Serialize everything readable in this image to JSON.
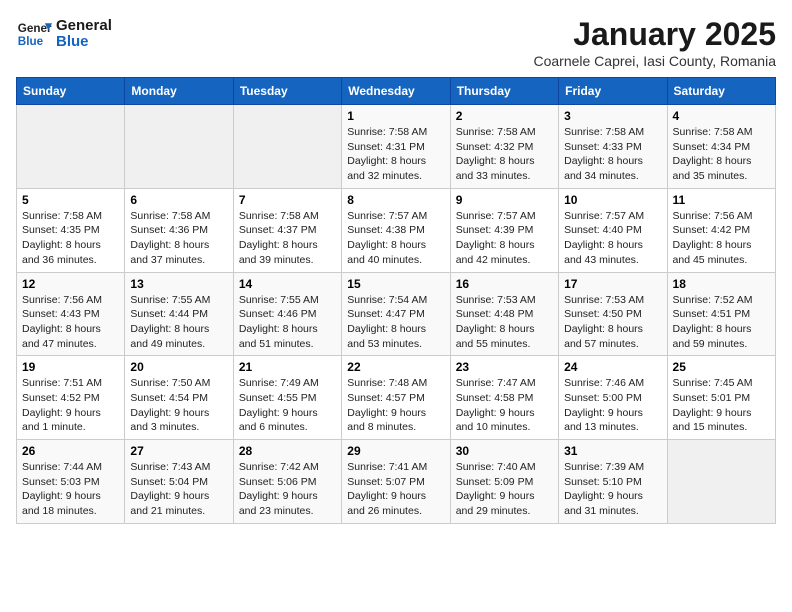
{
  "header": {
    "logo_line1": "General",
    "logo_line2": "Blue",
    "title": "January 2025",
    "subtitle": "Coarnele Caprei, Iasi County, Romania"
  },
  "weekdays": [
    "Sunday",
    "Monday",
    "Tuesday",
    "Wednesday",
    "Thursday",
    "Friday",
    "Saturday"
  ],
  "weeks": [
    [
      {
        "day": "",
        "info": ""
      },
      {
        "day": "",
        "info": ""
      },
      {
        "day": "",
        "info": ""
      },
      {
        "day": "1",
        "info": "Sunrise: 7:58 AM\nSunset: 4:31 PM\nDaylight: 8 hours and 32 minutes."
      },
      {
        "day": "2",
        "info": "Sunrise: 7:58 AM\nSunset: 4:32 PM\nDaylight: 8 hours and 33 minutes."
      },
      {
        "day": "3",
        "info": "Sunrise: 7:58 AM\nSunset: 4:33 PM\nDaylight: 8 hours and 34 minutes."
      },
      {
        "day": "4",
        "info": "Sunrise: 7:58 AM\nSunset: 4:34 PM\nDaylight: 8 hours and 35 minutes."
      }
    ],
    [
      {
        "day": "5",
        "info": "Sunrise: 7:58 AM\nSunset: 4:35 PM\nDaylight: 8 hours and 36 minutes."
      },
      {
        "day": "6",
        "info": "Sunrise: 7:58 AM\nSunset: 4:36 PM\nDaylight: 8 hours and 37 minutes."
      },
      {
        "day": "7",
        "info": "Sunrise: 7:58 AM\nSunset: 4:37 PM\nDaylight: 8 hours and 39 minutes."
      },
      {
        "day": "8",
        "info": "Sunrise: 7:57 AM\nSunset: 4:38 PM\nDaylight: 8 hours and 40 minutes."
      },
      {
        "day": "9",
        "info": "Sunrise: 7:57 AM\nSunset: 4:39 PM\nDaylight: 8 hours and 42 minutes."
      },
      {
        "day": "10",
        "info": "Sunrise: 7:57 AM\nSunset: 4:40 PM\nDaylight: 8 hours and 43 minutes."
      },
      {
        "day": "11",
        "info": "Sunrise: 7:56 AM\nSunset: 4:42 PM\nDaylight: 8 hours and 45 minutes."
      }
    ],
    [
      {
        "day": "12",
        "info": "Sunrise: 7:56 AM\nSunset: 4:43 PM\nDaylight: 8 hours and 47 minutes."
      },
      {
        "day": "13",
        "info": "Sunrise: 7:55 AM\nSunset: 4:44 PM\nDaylight: 8 hours and 49 minutes."
      },
      {
        "day": "14",
        "info": "Sunrise: 7:55 AM\nSunset: 4:46 PM\nDaylight: 8 hours and 51 minutes."
      },
      {
        "day": "15",
        "info": "Sunrise: 7:54 AM\nSunset: 4:47 PM\nDaylight: 8 hours and 53 minutes."
      },
      {
        "day": "16",
        "info": "Sunrise: 7:53 AM\nSunset: 4:48 PM\nDaylight: 8 hours and 55 minutes."
      },
      {
        "day": "17",
        "info": "Sunrise: 7:53 AM\nSunset: 4:50 PM\nDaylight: 8 hours and 57 minutes."
      },
      {
        "day": "18",
        "info": "Sunrise: 7:52 AM\nSunset: 4:51 PM\nDaylight: 8 hours and 59 minutes."
      }
    ],
    [
      {
        "day": "19",
        "info": "Sunrise: 7:51 AM\nSunset: 4:52 PM\nDaylight: 9 hours and 1 minute."
      },
      {
        "day": "20",
        "info": "Sunrise: 7:50 AM\nSunset: 4:54 PM\nDaylight: 9 hours and 3 minutes."
      },
      {
        "day": "21",
        "info": "Sunrise: 7:49 AM\nSunset: 4:55 PM\nDaylight: 9 hours and 6 minutes."
      },
      {
        "day": "22",
        "info": "Sunrise: 7:48 AM\nSunset: 4:57 PM\nDaylight: 9 hours and 8 minutes."
      },
      {
        "day": "23",
        "info": "Sunrise: 7:47 AM\nSunset: 4:58 PM\nDaylight: 9 hours and 10 minutes."
      },
      {
        "day": "24",
        "info": "Sunrise: 7:46 AM\nSunset: 5:00 PM\nDaylight: 9 hours and 13 minutes."
      },
      {
        "day": "25",
        "info": "Sunrise: 7:45 AM\nSunset: 5:01 PM\nDaylight: 9 hours and 15 minutes."
      }
    ],
    [
      {
        "day": "26",
        "info": "Sunrise: 7:44 AM\nSunset: 5:03 PM\nDaylight: 9 hours and 18 minutes."
      },
      {
        "day": "27",
        "info": "Sunrise: 7:43 AM\nSunset: 5:04 PM\nDaylight: 9 hours and 21 minutes."
      },
      {
        "day": "28",
        "info": "Sunrise: 7:42 AM\nSunset: 5:06 PM\nDaylight: 9 hours and 23 minutes."
      },
      {
        "day": "29",
        "info": "Sunrise: 7:41 AM\nSunset: 5:07 PM\nDaylight: 9 hours and 26 minutes."
      },
      {
        "day": "30",
        "info": "Sunrise: 7:40 AM\nSunset: 5:09 PM\nDaylight: 9 hours and 29 minutes."
      },
      {
        "day": "31",
        "info": "Sunrise: 7:39 AM\nSunset: 5:10 PM\nDaylight: 9 hours and 31 minutes."
      },
      {
        "day": "",
        "info": ""
      }
    ]
  ]
}
